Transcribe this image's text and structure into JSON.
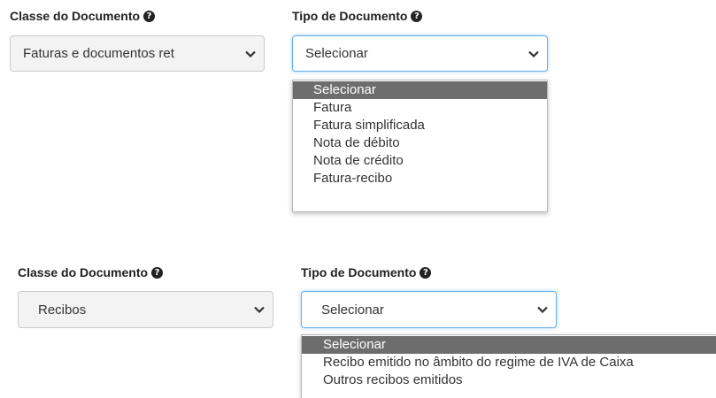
{
  "section1": {
    "class_label": "Classe do Documento",
    "type_label": "Tipo de Documento",
    "class_value": "Faturas e documentos ret",
    "type_value": "Selecionar",
    "options": [
      {
        "label": "Selecionar",
        "selected": true
      },
      {
        "label": "Fatura",
        "selected": false
      },
      {
        "label": "Fatura simplificada",
        "selected": false
      },
      {
        "label": "Nota de débito",
        "selected": false
      },
      {
        "label": "Nota de crédito",
        "selected": false
      },
      {
        "label": "Fatura-recibo",
        "selected": false
      }
    ]
  },
  "section2": {
    "class_label": "Classe do Documento",
    "type_label": "Tipo de Documento",
    "class_value": "Recibos",
    "type_value": "Selecionar",
    "options": [
      {
        "label": "Selecionar",
        "selected": true
      },
      {
        "label": "Recibo emitido no âmbito do regime de IVA de Caixa",
        "selected": false
      },
      {
        "label": "Outros recibos emitidos",
        "selected": false
      }
    ]
  },
  "icons": {
    "help": "question-circle-icon",
    "chevron": "chevron-down-icon"
  },
  "colors": {
    "focus_border": "#66afe9",
    "selected_option_bg": "#6d6d6d"
  }
}
